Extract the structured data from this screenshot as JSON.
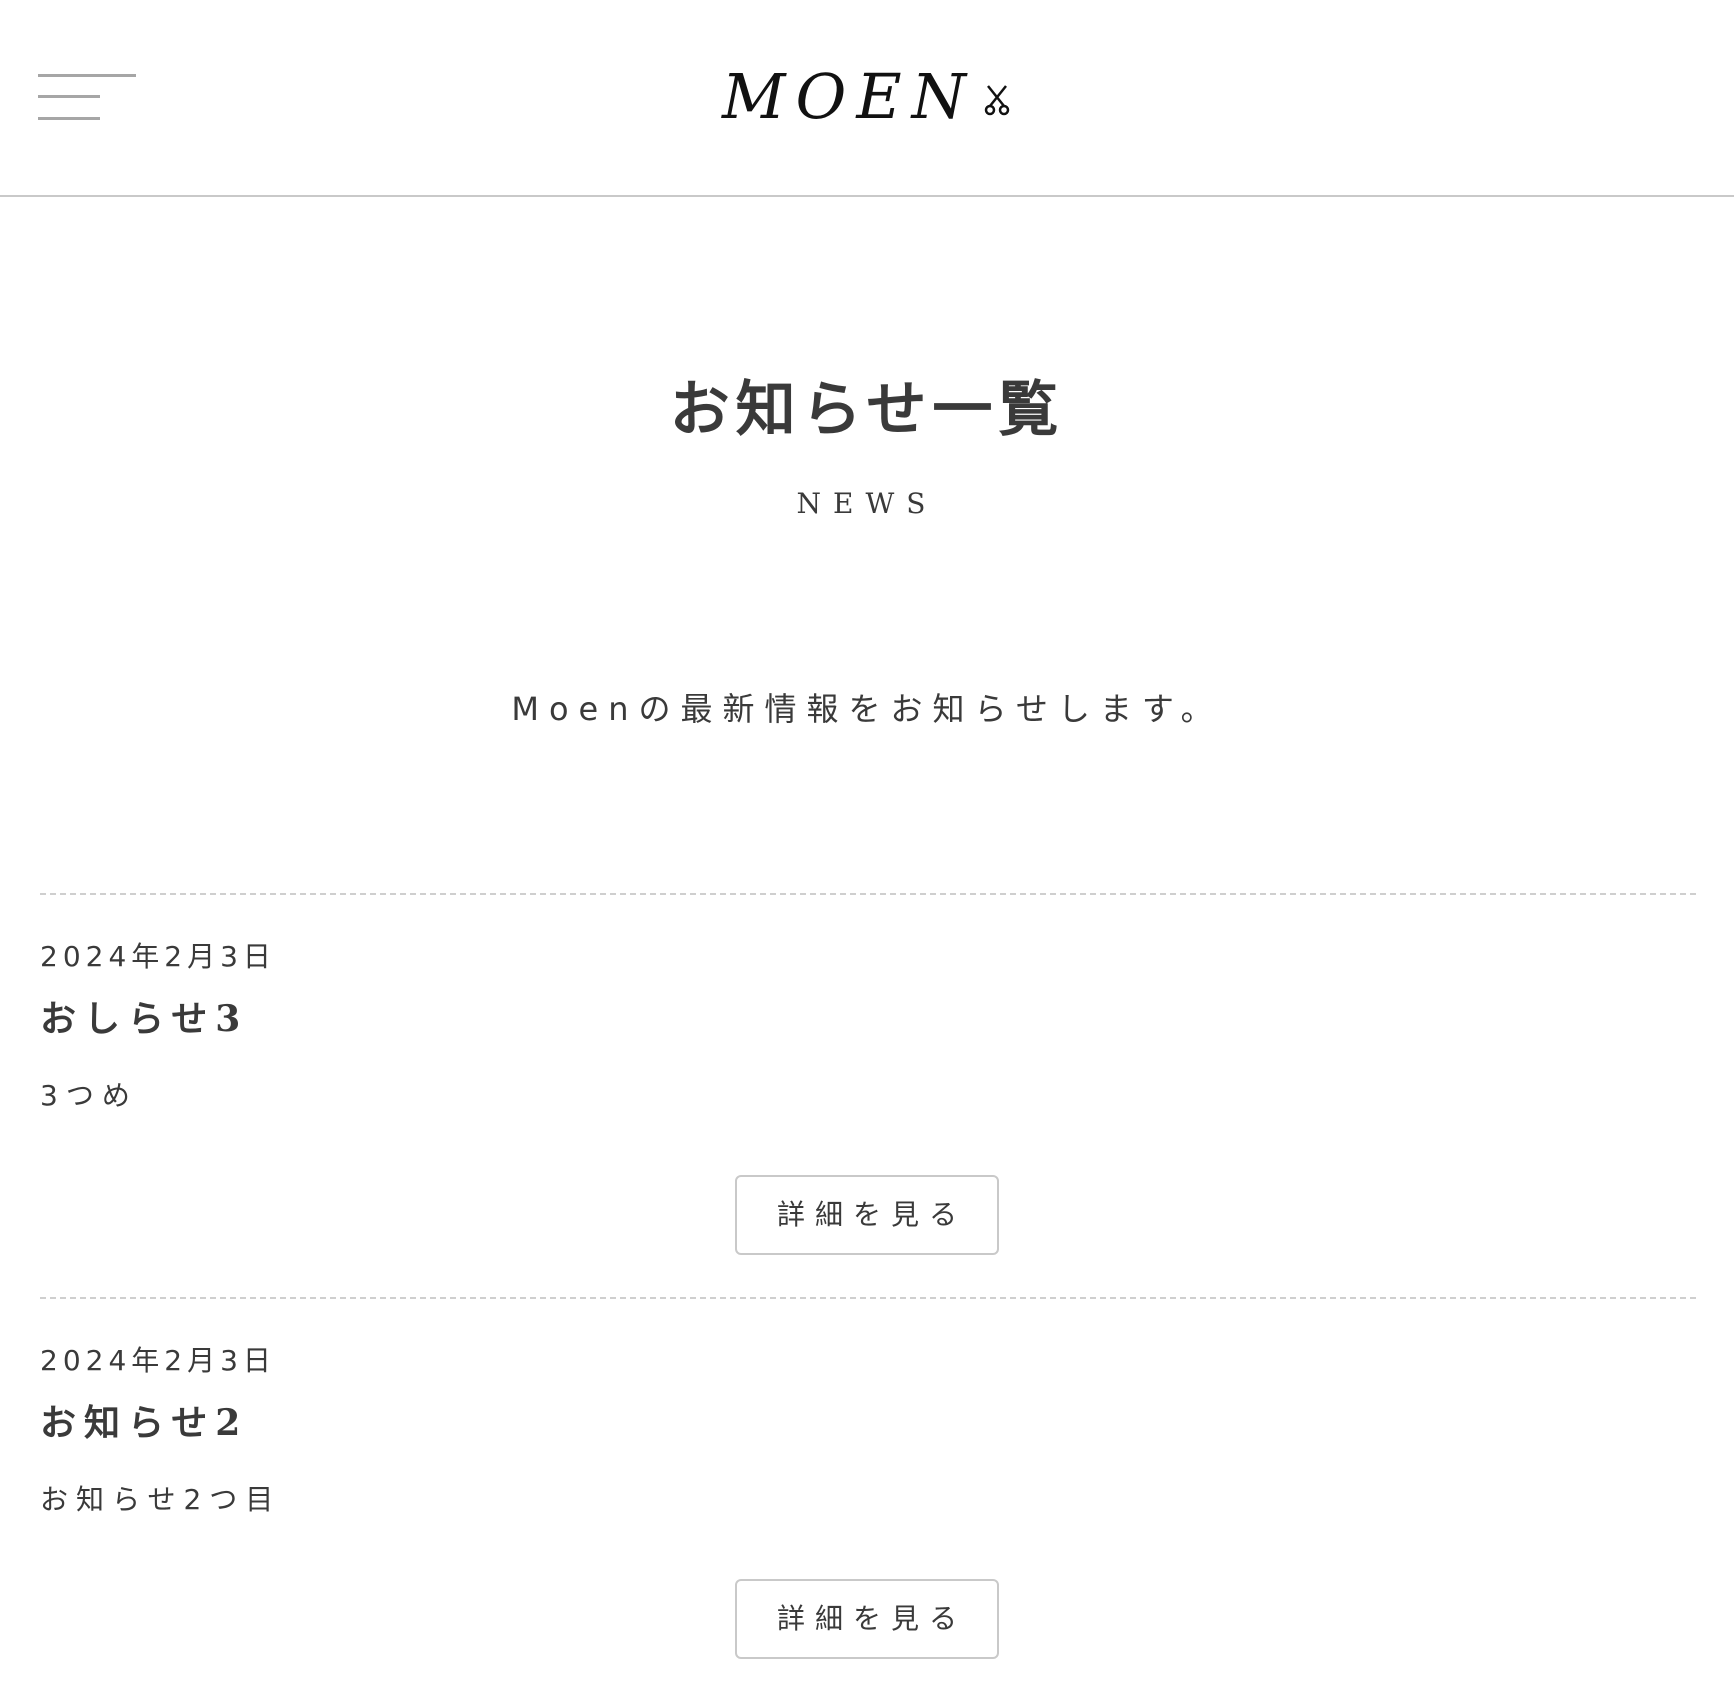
{
  "header": {
    "menu_icon": "hamburger-menu-icon",
    "logo_text": "MOEN",
    "logo_icon": "scissors-icon"
  },
  "page": {
    "title": "お知らせ一覧",
    "subtitle": "NEWS",
    "lead": "Moenの最新情報をお知らせします。"
  },
  "news": [
    {
      "date": "2024年2月3日",
      "title": "おしらせ3",
      "excerpt": "3つめ",
      "button_label": "詳細を見る"
    },
    {
      "date": "2024年2月3日",
      "title": "お知らせ2",
      "excerpt": "お知らせ2つ目",
      "button_label": "詳細を見る"
    }
  ],
  "colors": {
    "text": "#3a3a3a",
    "divider": "#cfcfcf",
    "menu_bar": "#a6a6a6",
    "header_border": "#c9c9c9"
  }
}
